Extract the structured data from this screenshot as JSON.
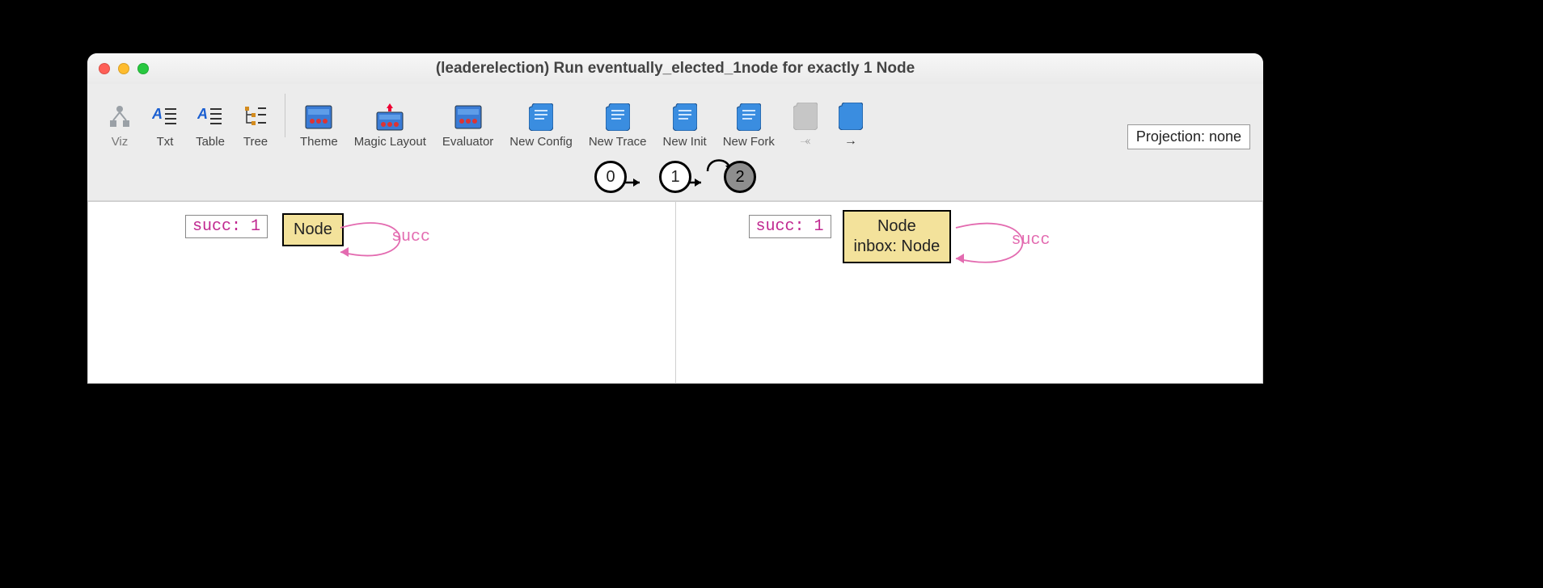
{
  "window": {
    "title": "(leaderelection) Run eventually_elected_1node for exactly 1 Node"
  },
  "toolbar": {
    "viz": "Viz",
    "txt": "Txt",
    "table": "Table",
    "tree": "Tree",
    "theme": "Theme",
    "magic": "Magic Layout",
    "eval": "Evaluator",
    "newconfig": "New Config",
    "newtrace": "New Trace",
    "newinit": "New Init",
    "newfork": "New Fork",
    "projection": "Projection: none"
  },
  "trace": {
    "states": [
      "0",
      "1",
      "2"
    ],
    "active_index": 2
  },
  "pane_left": {
    "succ_label": "succ: 1",
    "node_label": "Node",
    "edge_label": "succ"
  },
  "pane_right": {
    "succ_label": "succ: 1",
    "node_line1": "Node",
    "node_line2": "inbox: Node",
    "edge_label": "succ"
  }
}
